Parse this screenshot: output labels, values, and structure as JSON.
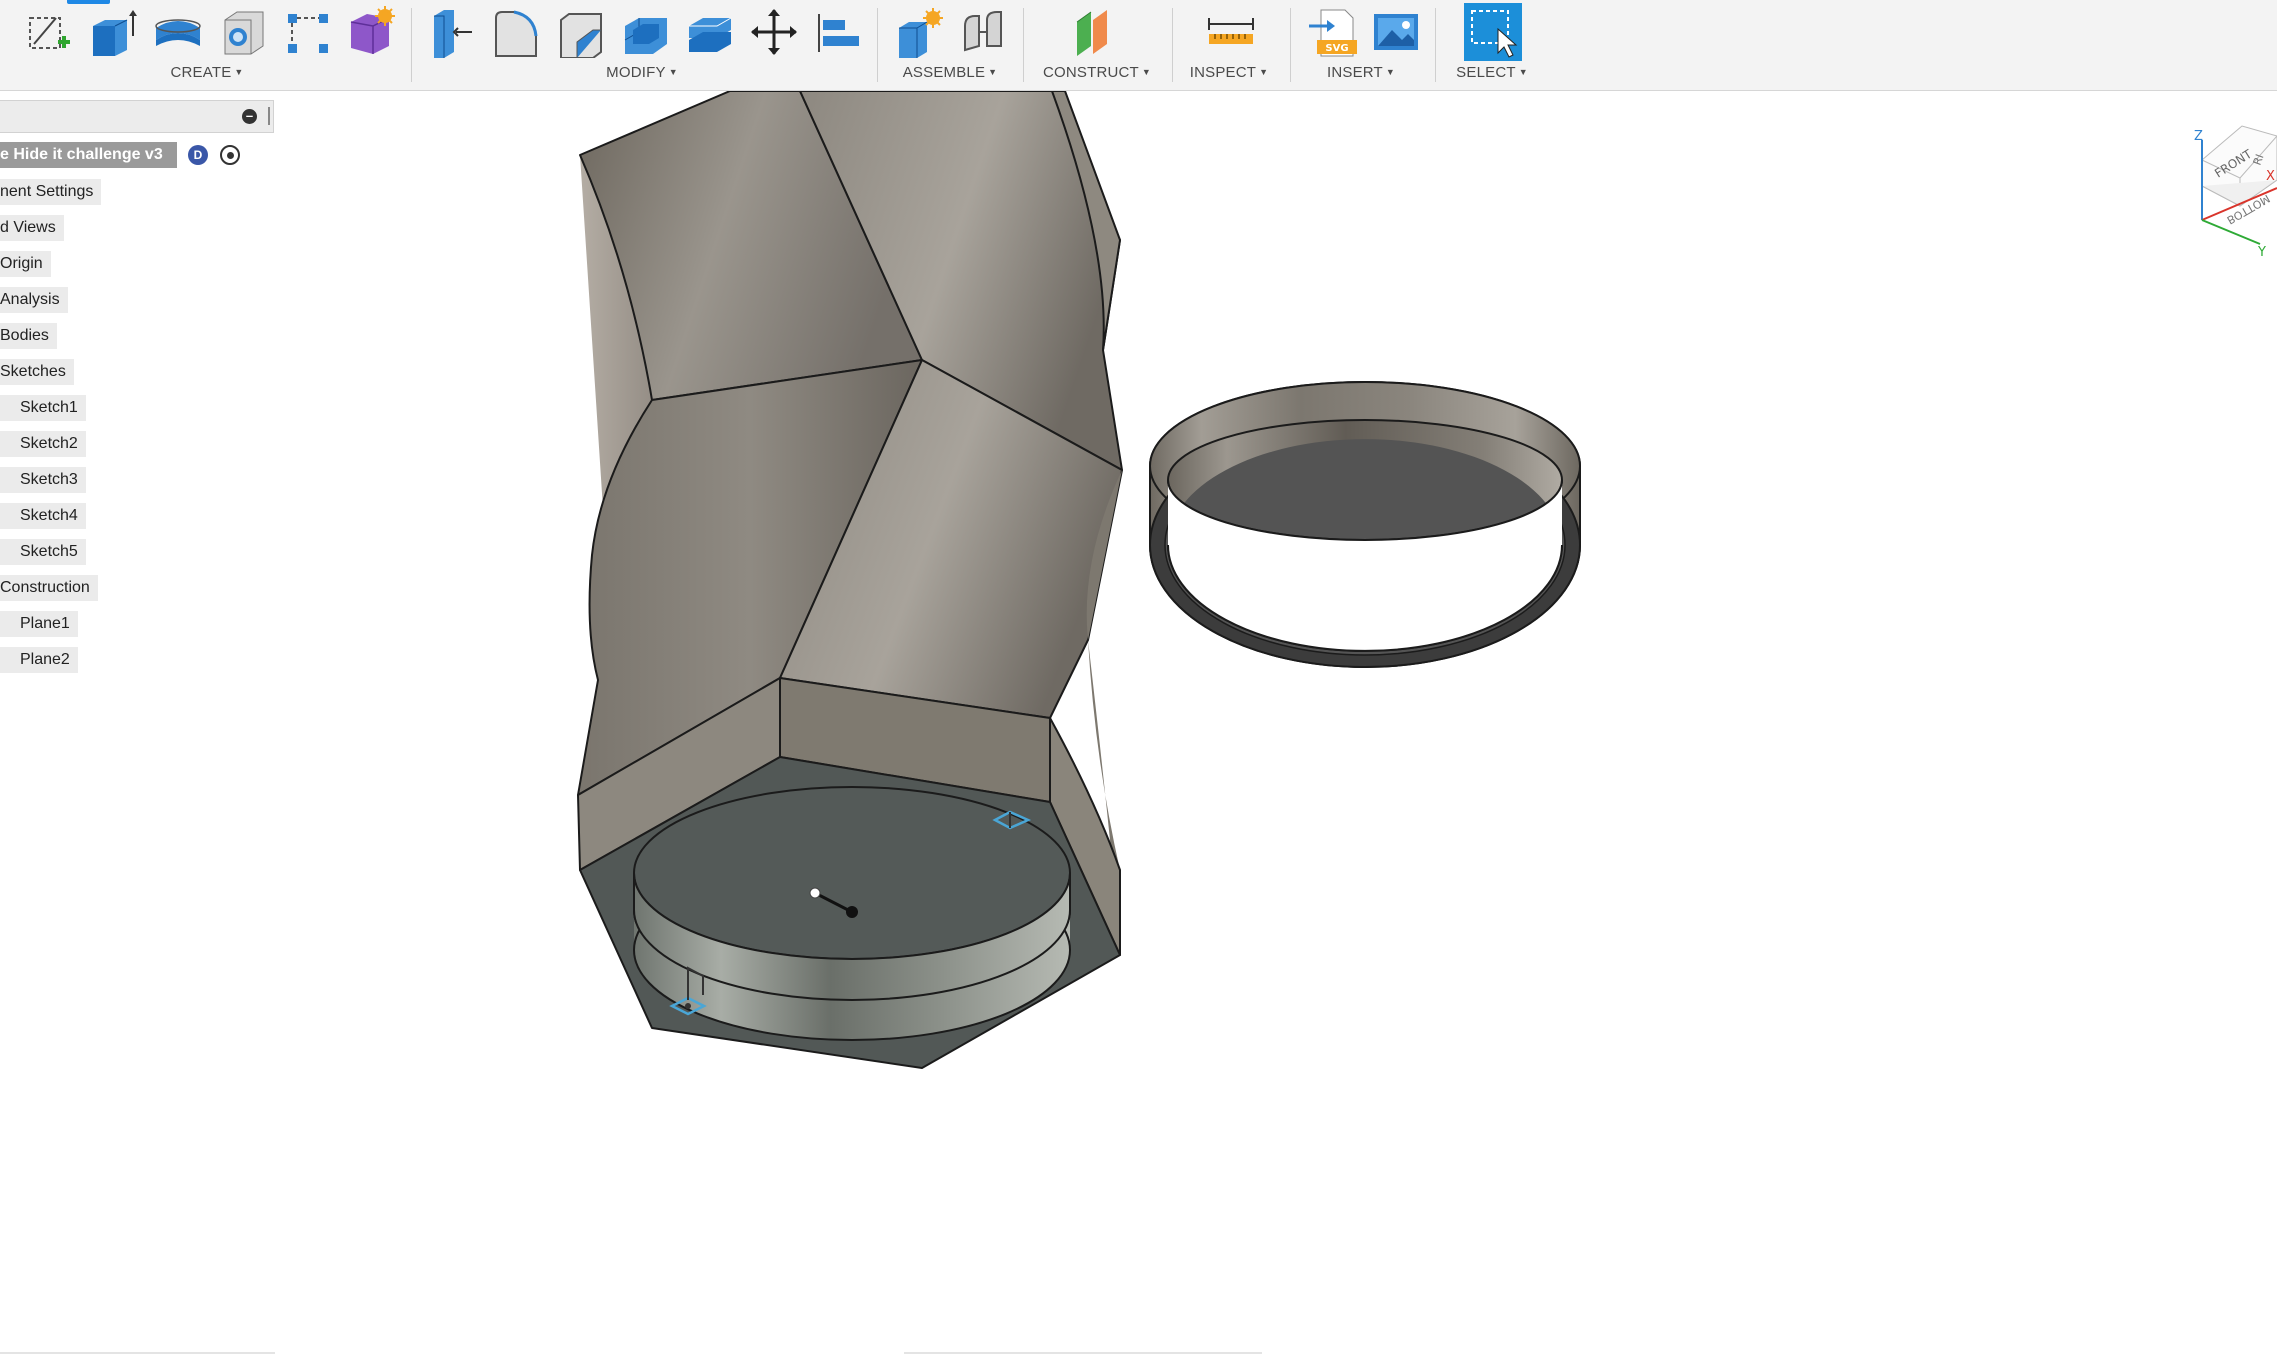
{
  "toolbar": {
    "groups": {
      "create": "CREATE",
      "modify": "MODIFY",
      "assemble": "ASSEMBLE",
      "construct": "CONSTRUCT",
      "inspect": "INSPECT",
      "insert": "INSERT",
      "select": "SELECT"
    },
    "icons": {
      "create": [
        "create-sketch-icon",
        "extrude-icon",
        "revolve-icon",
        "hole-icon",
        "pattern-icon",
        "create-form-icon"
      ],
      "modify": [
        "press-pull-icon",
        "fillet-icon",
        "chamfer-icon",
        "shell-icon",
        "combine-icon",
        "move-icon",
        "align-icon"
      ],
      "assemble": [
        "new-component-icon",
        "joint-icon"
      ],
      "construct": [
        "offset-plane-icon"
      ],
      "inspect": [
        "measure-icon"
      ],
      "insert": [
        "insert-svg-icon",
        "insert-image-icon"
      ],
      "select": [
        "select-icon"
      ]
    },
    "svg_badge": "SVG",
    "accent_color": "#1e88e5"
  },
  "browser": {
    "root": "e Hide it challenge v3",
    "items": [
      {
        "label": "nent Settings"
      },
      {
        "label": "d Views"
      },
      {
        "label": "Origin"
      },
      {
        "label": "Analysis"
      },
      {
        "label": "Bodies"
      },
      {
        "label": "Sketches"
      },
      {
        "label": "Sketch1"
      },
      {
        "label": "Sketch2"
      },
      {
        "label": "Sketch3"
      },
      {
        "label": "Sketch4"
      },
      {
        "label": "Sketch5"
      },
      {
        "label": "Construction"
      },
      {
        "label": "Plane1"
      },
      {
        "label": "Plane2"
      }
    ],
    "badge_text": "D"
  },
  "viewcube": {
    "front": "FRONT",
    "bottom": "BOTTOM",
    "right": "RI",
    "axis_z": "Z",
    "axis_x": "X",
    "axis_y": "Y"
  }
}
